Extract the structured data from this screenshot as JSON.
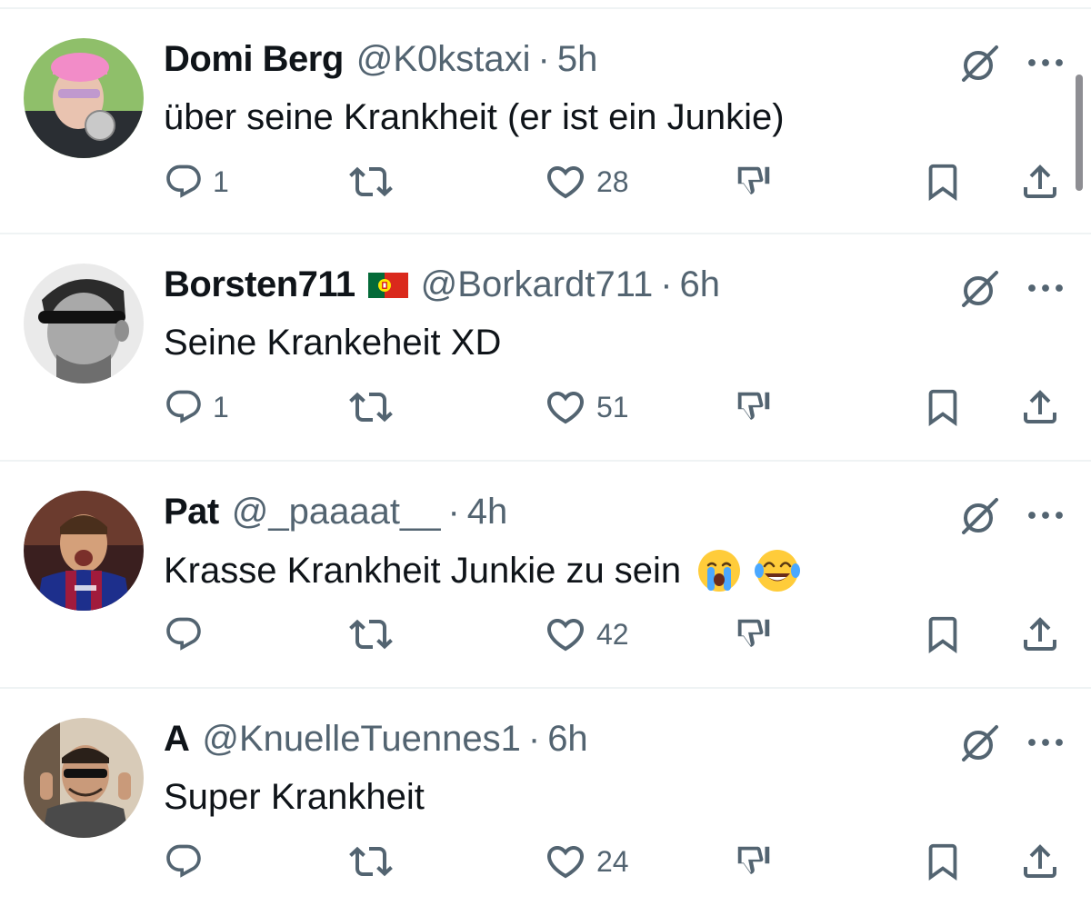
{
  "theme": {
    "text_primary": "#0f1419",
    "text_secondary": "#536471",
    "divider": "#eff3f4"
  },
  "replies": [
    {
      "display_name": "Domi Berg",
      "handle": "@K0kstaxi",
      "separator": "·",
      "time": "5h",
      "text": "über seine Krankheit (er ist ein Junkie)",
      "counts": {
        "replies": "1",
        "reposts": "",
        "likes": "28"
      }
    },
    {
      "display_name": "Borsten711",
      "flag": "portugal-flag",
      "handle": "@Borkardt711",
      "separator": "·",
      "time": "6h",
      "text": "Seine Krankeheit XD",
      "counts": {
        "replies": "1",
        "reposts": "",
        "likes": "51"
      }
    },
    {
      "display_name": "Pat",
      "handle": "@_paaaat__",
      "separator": "·",
      "time": "4h",
      "text": "Krasse Krankheit Junkie zu sein",
      "emojis": [
        "loudly-crying-face",
        "face-with-tears-of-joy"
      ],
      "counts": {
        "replies": "",
        "reposts": "",
        "likes": "42"
      }
    },
    {
      "display_name": "A",
      "handle": "@KnuelleTuennes1",
      "separator": "·",
      "time": "6h",
      "text": "Super Krankheit",
      "counts": {
        "replies": "",
        "reposts": "",
        "likes": "24"
      }
    }
  ],
  "icons": {
    "grok": "grok-icon",
    "more": "more-icon",
    "reply": "reply-icon",
    "repost": "repost-icon",
    "like": "heart-icon",
    "dislike": "dislike-icon",
    "bookmark": "bookmark-icon",
    "share": "share-icon"
  }
}
